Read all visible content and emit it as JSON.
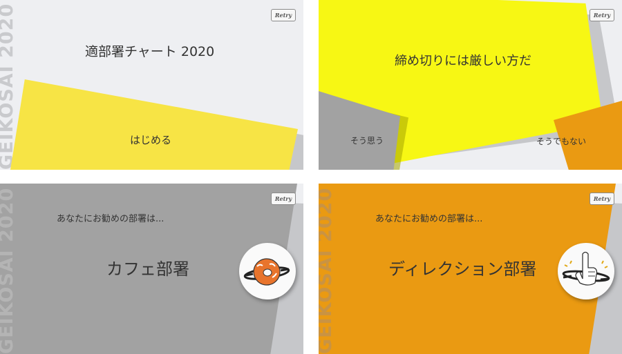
{
  "brand_vertical": "GEIKOSAI 2020",
  "retry_label": "Retry",
  "start": {
    "title": "適部署チャート 2020",
    "start_button": "はじめる"
  },
  "question": {
    "text": "締め切りには厳しい方だ",
    "yes_label": "そう思う",
    "no_label": "そうでもない"
  },
  "result_cafe": {
    "intro": "あなたにお勧めの部署は...",
    "department": "カフェ部署",
    "icon": "donut-icon"
  },
  "result_direction": {
    "intro": "あなたにお勧めの部署は...",
    "department": "ディレクション部署",
    "icon": "pointing-hand-icon"
  },
  "colors": {
    "background": "#eeeff2",
    "start_yellow": "#f7e445",
    "question_yellow": "#f7f714",
    "gray": "#a2a2a2",
    "orange": "#ea9a12",
    "shadow": "#c6c7ca"
  }
}
